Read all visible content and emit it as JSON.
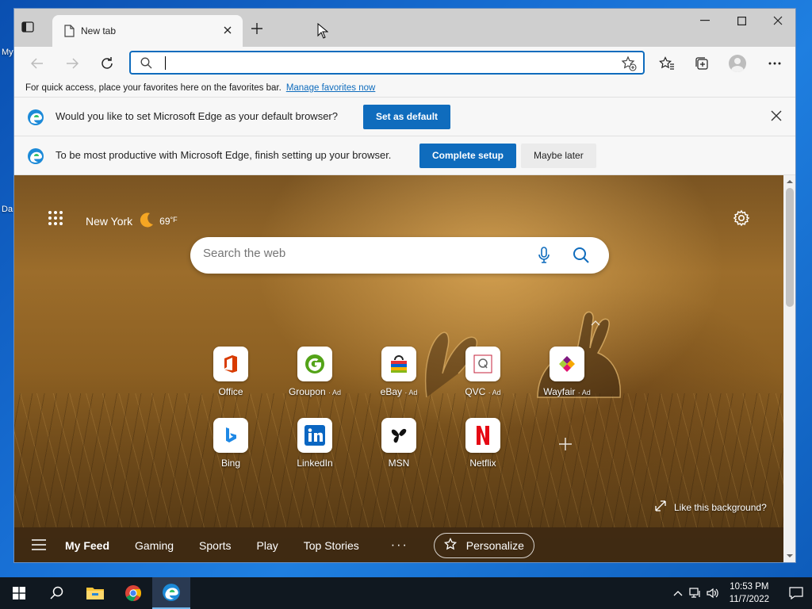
{
  "desktop": {
    "labels": [
      "My",
      "Da"
    ]
  },
  "tab": {
    "title": "New tab"
  },
  "address": {
    "value": "",
    "placeholder": ""
  },
  "favbar": {
    "text": "For quick access, place your favorites here on the favorites bar.",
    "link": "Manage favorites now"
  },
  "infobars": [
    {
      "message": "Would you like to set Microsoft Edge as your default browser?",
      "primary": "Set as default"
    },
    {
      "message": "To be most productive with Microsoft Edge, finish setting up your browser.",
      "primary": "Complete setup",
      "secondary": "Maybe later"
    }
  ],
  "ntp": {
    "location": "New York",
    "temperature": "69",
    "unit": "°F",
    "search_placeholder": "Search the web",
    "tiles": [
      {
        "label": "Office",
        "ad": ""
      },
      {
        "label": "Groupon",
        "ad": "· Ad"
      },
      {
        "label": "eBay",
        "ad": "· Ad"
      },
      {
        "label": "QVC",
        "ad": "· Ad"
      },
      {
        "label": "Wayfair",
        "ad": "· Ad"
      },
      {
        "label": "Bing",
        "ad": ""
      },
      {
        "label": "LinkedIn",
        "ad": ""
      },
      {
        "label": "MSN",
        "ad": ""
      },
      {
        "label": "Netflix",
        "ad": ""
      }
    ],
    "like_background": "Like this background?",
    "feed": {
      "items": [
        "My Feed",
        "Gaming",
        "Sports",
        "Play",
        "Top Stories"
      ],
      "more": "···",
      "personalize": "Personalize"
    }
  },
  "taskbar": {
    "time": "10:53 PM",
    "date": "11/7/2022"
  },
  "colors": {
    "accent": "#0f6cbd",
    "taskbar": "#101820"
  }
}
